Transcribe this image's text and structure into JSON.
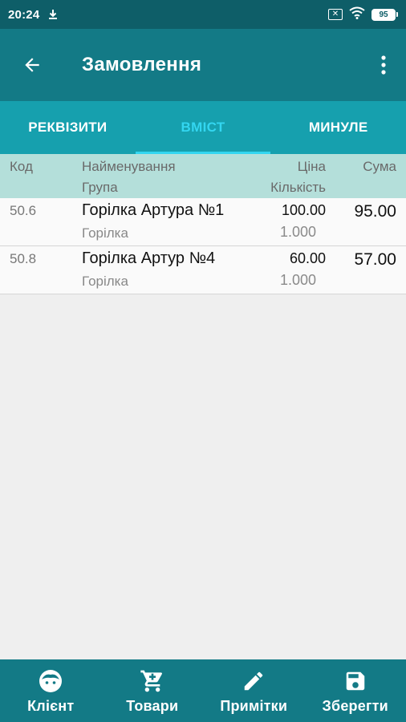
{
  "status_bar": {
    "time": "20:24",
    "battery": "95"
  },
  "app_bar": {
    "title": "Замовлення"
  },
  "tabs": [
    {
      "label": "РЕКВІЗИТИ",
      "active": false
    },
    {
      "label": "ВМІСТ",
      "active": true
    },
    {
      "label": "МИНУЛЕ",
      "active": false
    }
  ],
  "table": {
    "headers": {
      "code": "Код",
      "name": "Найменування",
      "group": "Група",
      "price": "Ціна",
      "quantity": "Кількість",
      "sum": "Сума"
    },
    "rows": [
      {
        "code": "50.6",
        "name": "Горілка Артура №1",
        "group": "Горілка",
        "price": "100.00",
        "quantity": "1.000",
        "sum": "95.00"
      },
      {
        "code": "50.8",
        "name": "Горілка Артур №4",
        "group": "Горілка",
        "price": "60.00",
        "quantity": "1.000",
        "sum": "57.00"
      }
    ]
  },
  "bottom_nav": [
    {
      "label": "Клієнт",
      "icon": "face-icon"
    },
    {
      "label": "Товари",
      "icon": "cart-icon"
    },
    {
      "label": "Примітки",
      "icon": "pencil-icon"
    },
    {
      "label": "Зберегти",
      "icon": "save-icon"
    }
  ],
  "colors": {
    "status_bar": "#0e5e68",
    "app_bar": "#137a86",
    "tabs": "#16a0ae",
    "tab_active": "#33d6f0",
    "table_header": "#b4dfda"
  }
}
